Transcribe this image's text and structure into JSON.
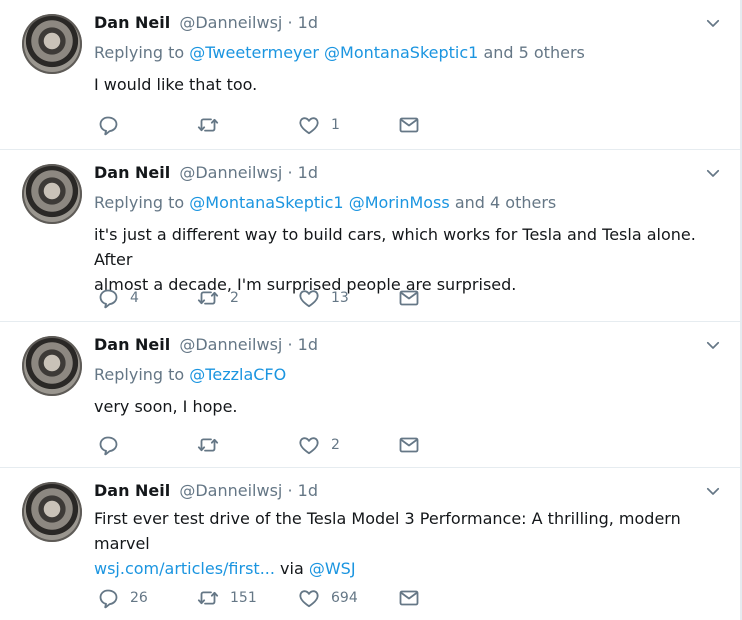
{
  "tweets": [
    {
      "name": "Dan Neil",
      "handle": "@Danneilwsj",
      "dot": "·",
      "time": "1d",
      "replying_prefix": "Replying to",
      "mentions": [
        "@Tweetermeyer",
        "@MontanaSkeptic1"
      ],
      "others": "and 5 others",
      "text_lines": [
        "I would like that too."
      ],
      "reply_count": "",
      "retweet_count": "",
      "like_count": "1"
    },
    {
      "name": "Dan Neil",
      "handle": "@Danneilwsj",
      "dot": "·",
      "time": "1d",
      "replying_prefix": "Replying to",
      "mentions": [
        "@MontanaSkeptic1",
        "@MorinMoss"
      ],
      "others": "and 4 others",
      "text_lines": [
        "it's just a different way to build cars, which works for Tesla and Tesla alone. After",
        "almost a decade, I'm surprised people are surprised."
      ],
      "reply_count": "4",
      "retweet_count": "2",
      "like_count": "13"
    },
    {
      "name": "Dan Neil",
      "handle": "@Danneilwsj",
      "dot": "·",
      "time": "1d",
      "replying_prefix": "Replying to",
      "mentions": [
        "@TezzlaCFO"
      ],
      "others": "",
      "text_lines": [
        "very soon, I hope."
      ],
      "reply_count": "",
      "retweet_count": "",
      "like_count": "2"
    },
    {
      "name": "Dan Neil",
      "handle": "@Danneilwsj",
      "dot": "·",
      "time": "1d",
      "text_lines": [
        "First ever test drive of the Tesla Model 3 Performance: A thrilling, modern marvel"
      ],
      "link_text": "wsj.com/articles/first...",
      "via": "via",
      "via_handle": "@WSJ",
      "reply_count": "26",
      "retweet_count": "151",
      "like_count": "694"
    }
  ],
  "colors": {
    "text": "#14171a",
    "secondary": "#657786",
    "link": "#1b95e0",
    "divider": "#e6ecf0"
  },
  "icons": [
    "reply-icon",
    "retweet-icon",
    "like-icon",
    "direct-message-icon",
    "chevron-down-icon"
  ]
}
